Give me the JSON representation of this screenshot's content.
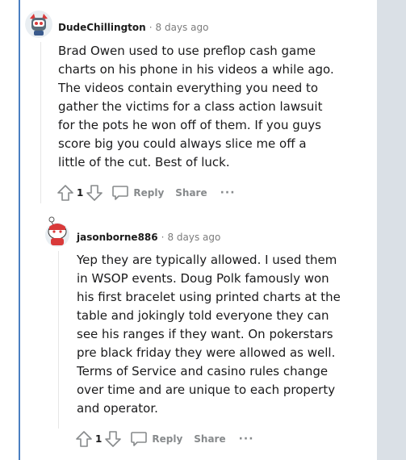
{
  "comments": [
    {
      "author": "DudeChillington",
      "time": "8 days ago",
      "body": "Brad Owen used to use preflop cash game charts on his phone in his videos a while ago. The videos contain everything you need to gather the victims for a class action lawsuit for the pots he won off of them. If you guys score big you could always slice me off a little of the cut. Best of luck.",
      "votes": "1",
      "reply_label": "Reply",
      "share_label": "Share",
      "more_label": "···"
    },
    {
      "author": "jasonborne886",
      "time": "8 days ago",
      "body": "Yep they are typically allowed. I used them in WSOP events. Doug Polk famously won his first bracelet using printed charts at the table and jokingly told everyone they can see his ranges if they want. On pokerstars pre black friday they were allowed as well. Terms of Service and casino rules change over time and are unique to each property and operator.",
      "votes": "1",
      "reply_label": "Reply",
      "share_label": "Share",
      "more_label": "···"
    }
  ],
  "separator": "·",
  "colors": {
    "rail": "#4a7fc1",
    "background": "#dae0e6",
    "muted": "#878a8c"
  },
  "icons": {
    "upvote": "arrow-up-outline",
    "downvote": "arrow-down-outline",
    "reply": "speech-bubble-outline",
    "more": "ellipsis"
  }
}
